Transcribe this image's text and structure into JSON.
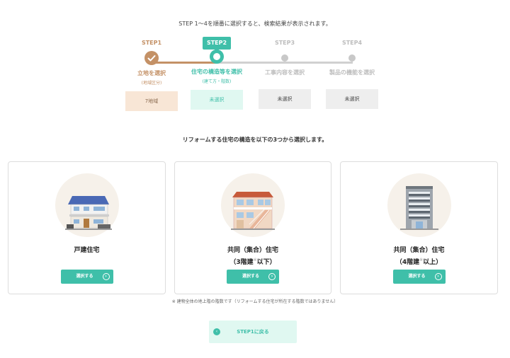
{
  "intro_text": "STEP 1〜4を順番に選択すると、検索結果が表示されます。",
  "steps": [
    {
      "label": "STEP1",
      "name": "立地を選択",
      "sub": "(地域区分)",
      "value": "7地域"
    },
    {
      "label": "STEP2",
      "name": "住宅の構造等を選択",
      "sub": "(建て方・階数)",
      "value": "未選択"
    },
    {
      "label": "STEP3",
      "name": "工事内容を選択",
      "sub": "",
      "value": "未選択"
    },
    {
      "label": "STEP4",
      "name": "製品の機能を選択",
      "sub": "",
      "value": "未選択"
    }
  ],
  "instruction": "リフォームする住宅の構造を以下の3つから選択します。",
  "cards": [
    {
      "title_line1": "戸建住宅",
      "title_line2": "",
      "button": "選択する"
    },
    {
      "title_line1": "共同（集合）住宅",
      "title_line2": "（3階建",
      "title_sup": "※",
      "title_line2_end": "以下）",
      "button": "選択する"
    },
    {
      "title_line1": "共同（集合）住宅",
      "title_line2": "（4階建",
      "title_sup": "※",
      "title_line2_end": "以上）",
      "button": "選択する"
    }
  ],
  "note": "※ 建物全体の地上階の階数です（リフォームする住宅が所在する階数ではありません）",
  "back_button": "STEP1に戻る",
  "colors": {
    "accent": "#3fbfa9",
    "done": "#c49166",
    "inactive": "#c8c8c8"
  },
  "icons": {
    "check": "✓",
    "arrow_right": "›",
    "arrow_left": "‹"
  }
}
